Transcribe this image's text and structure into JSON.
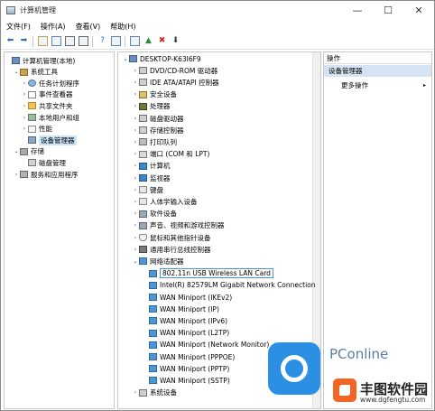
{
  "window": {
    "title": "计算机管理",
    "controls": {
      "minimize": "—",
      "maximize": "☐",
      "close": "✕"
    }
  },
  "menubar": [
    "文件(F)",
    "操作(A)",
    "查看(V)",
    "帮助(H)"
  ],
  "toolbar": {
    "buttons": [
      {
        "name": "back-arrow-icon",
        "glyph": "⬅",
        "color": "#2f6fb4"
      },
      {
        "name": "forward-arrow-icon",
        "glyph": "➡",
        "color": "#2f6fb4"
      },
      {
        "name": "up-folder-icon",
        "glyph": "",
        "color": "#c9a04b"
      },
      {
        "name": "show-hide-tree-icon",
        "glyph": "",
        "color": "#5f86b3"
      },
      {
        "name": "properties-icon",
        "glyph": "",
        "color": "#6a6a6a"
      },
      {
        "name": "export-icon",
        "glyph": "",
        "color": "#6a6a6a"
      },
      {
        "name": "help-icon",
        "glyph": "?",
        "color": "#2f6fb4"
      },
      {
        "name": "action-view-icon",
        "glyph": "",
        "color": "#5f86b3"
      },
      {
        "name": "scan-hardware-icon",
        "glyph": "",
        "color": "#5f86b3"
      },
      {
        "name": "update-driver-icon",
        "glyph": "▲",
        "color": "#2e8b3a"
      },
      {
        "name": "uninstall-icon",
        "glyph": "✖",
        "color": "#d12a2a"
      },
      {
        "name": "enable-device-icon",
        "glyph": "⬇",
        "color": "#3a3a3a"
      }
    ]
  },
  "left_tree": [
    {
      "label": "计算机管理(本地)",
      "icon": "computer",
      "indent": 0,
      "arrow": ""
    },
    {
      "label": "系统工具",
      "icon": "tools",
      "indent": 1,
      "arrow": "⌄"
    },
    {
      "label": "任务计划程序",
      "icon": "clock",
      "indent": 2,
      "arrow": "›"
    },
    {
      "label": "事件查看器",
      "icon": "log",
      "indent": 2,
      "arrow": "›"
    },
    {
      "label": "共享文件夹",
      "icon": "folder",
      "indent": 2,
      "arrow": "›"
    },
    {
      "label": "本地用户和组",
      "icon": "users",
      "indent": 2,
      "arrow": "›"
    },
    {
      "label": "性能",
      "icon": "perf",
      "indent": 2,
      "arrow": "›"
    },
    {
      "label": "设备管理器",
      "icon": "devmgr",
      "indent": 2,
      "arrow": "",
      "selected": true
    },
    {
      "label": "存储",
      "icon": "storage",
      "indent": 1,
      "arrow": "⌄"
    },
    {
      "label": "磁盘管理",
      "icon": "disk",
      "indent": 2,
      "arrow": ""
    },
    {
      "label": "服务和应用程序",
      "icon": "services",
      "indent": 1,
      "arrow": "›"
    }
  ],
  "device_tree": [
    {
      "label": "DESKTOP-K63I6F9",
      "icon": "computer",
      "indent": 0,
      "arrow": "⌄"
    },
    {
      "label": "DVD/CD-ROM 驱动器",
      "icon": "drive",
      "indent": 1,
      "arrow": "›"
    },
    {
      "label": "IDE ATA/ATAPI 控制器",
      "icon": "drive",
      "indent": 1,
      "arrow": "›"
    },
    {
      "label": "安全设备",
      "icon": "shield",
      "indent": 1,
      "arrow": "›"
    },
    {
      "label": "处理器",
      "icon": "chip",
      "indent": 1,
      "arrow": "›"
    },
    {
      "label": "磁盘驱动器",
      "icon": "drive",
      "indent": 1,
      "arrow": "›"
    },
    {
      "label": "存储控制器",
      "icon": "drive",
      "indent": 1,
      "arrow": "›"
    },
    {
      "label": "打印队列",
      "icon": "printer",
      "indent": 1,
      "arrow": "›"
    },
    {
      "label": "端口 (COM 和 LPT)",
      "icon": "port",
      "indent": 1,
      "arrow": "›"
    },
    {
      "label": "计算机",
      "icon": "monitor",
      "indent": 1,
      "arrow": "›"
    },
    {
      "label": "监视器",
      "icon": "monitor",
      "indent": 1,
      "arrow": "›"
    },
    {
      "label": "键盘",
      "icon": "keyboard",
      "indent": 1,
      "arrow": "›"
    },
    {
      "label": "人体学输入设备",
      "icon": "keyboard",
      "indent": 1,
      "arrow": "›"
    },
    {
      "label": "软件设备",
      "icon": "speaker",
      "indent": 1,
      "arrow": "›"
    },
    {
      "label": "声音、视频和游戏控制器",
      "icon": "speaker",
      "indent": 1,
      "arrow": "›"
    },
    {
      "label": "鼠标和其他指针设备",
      "icon": "mouse",
      "indent": 1,
      "arrow": "›"
    },
    {
      "label": "通用串行总线控制器",
      "icon": "usb",
      "indent": 1,
      "arrow": "›"
    },
    {
      "label": "网络适配器",
      "icon": "net",
      "indent": 1,
      "arrow": "⌄"
    },
    {
      "label": "802.11n USB Wireless LAN Card",
      "icon": "net",
      "indent": 2,
      "arrow": "",
      "focused": true
    },
    {
      "label": "Intel(R) 82579LM Gigabit Network Connection",
      "icon": "net",
      "indent": 2,
      "arrow": ""
    },
    {
      "label": "WAN Miniport (IKEv2)",
      "icon": "net",
      "indent": 2,
      "arrow": ""
    },
    {
      "label": "WAN Miniport (IP)",
      "icon": "net",
      "indent": 2,
      "arrow": ""
    },
    {
      "label": "WAN Miniport (IPv6)",
      "icon": "net",
      "indent": 2,
      "arrow": ""
    },
    {
      "label": "WAN Miniport (L2TP)",
      "icon": "net",
      "indent": 2,
      "arrow": ""
    },
    {
      "label": "WAN Miniport (Network Monitor)",
      "icon": "net",
      "indent": 2,
      "arrow": ""
    },
    {
      "label": "WAN Miniport (PPPOE)",
      "icon": "net",
      "indent": 2,
      "arrow": ""
    },
    {
      "label": "WAN Miniport (PPTP)",
      "icon": "net",
      "indent": 2,
      "arrow": ""
    },
    {
      "label": "WAN Miniport (SSTP)",
      "icon": "net",
      "indent": 2,
      "arrow": ""
    },
    {
      "label": "系统设备",
      "icon": "drive",
      "indent": 1,
      "arrow": "›"
    }
  ],
  "actions": {
    "header": "操作",
    "selected": "设备管理器",
    "more": "更多操作",
    "more_chevron": "▸"
  },
  "watermark": {
    "brand": "PConline",
    "site_name": "丰图软件园",
    "url": "www.dgfengtu.com"
  }
}
